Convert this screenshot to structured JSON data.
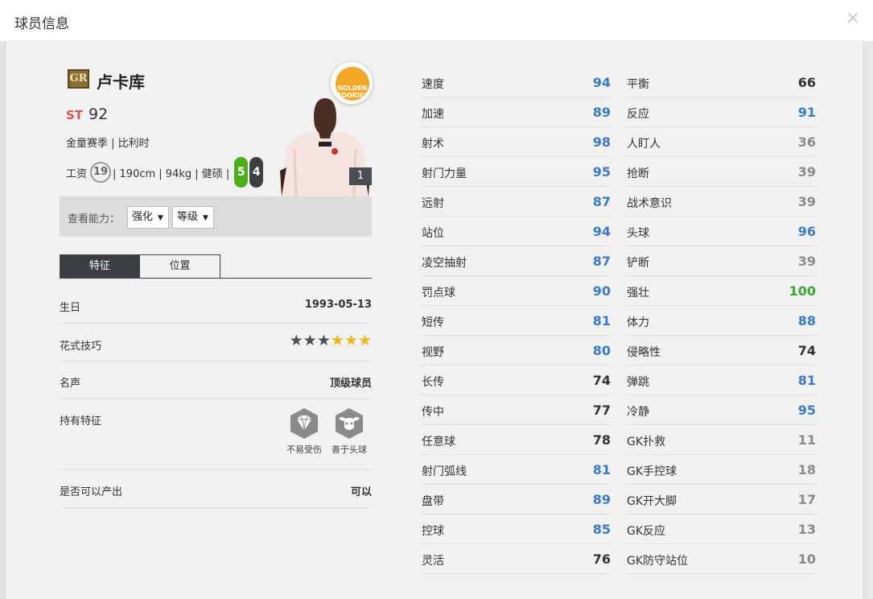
{
  "dialog": {
    "title": "球员信息",
    "close_label": "×"
  },
  "player": {
    "grade": "GR",
    "name": "卢卡库",
    "position": "ST",
    "overall": "92",
    "season_line": "金童赛季 | 比利时",
    "salary_prefix": "工资",
    "salary": "19",
    "body_line": "| 190cm | 94kg | 健硕 |",
    "left_foot": "5",
    "right_foot": "4",
    "card_badge_text": "GOLDEN ROOKIES",
    "card_level": "1"
  },
  "filter": {
    "label": "查看能力：",
    "enhance": "强化",
    "level": "等级"
  },
  "tabs": [
    {
      "label": "特征",
      "active": true
    },
    {
      "label": "位置",
      "active": false
    }
  ],
  "info": {
    "birthday_label": "生日",
    "birthday": "1993-05-13",
    "skill_label": "花式技巧",
    "skill_stars": 3,
    "skill_stars_max": 6,
    "fame_label": "名声",
    "fame": "顶级球员",
    "traits_label": "持有特征",
    "traits": [
      {
        "label": "不易受伤",
        "icon": "diamond-icon"
      },
      {
        "label": "善于头球",
        "icon": "bull-icon"
      }
    ],
    "produce_label": "是否可以产出",
    "produce": "可以"
  },
  "colors": {
    "blue": "#3a7bc4",
    "dark": "#333333",
    "gray": "#8a8a8a",
    "green": "#3aa832"
  },
  "stats_left": [
    {
      "name": "速度",
      "value": "94",
      "color": "blue"
    },
    {
      "name": "加速",
      "value": "89",
      "color": "blue"
    },
    {
      "name": "射术",
      "value": "98",
      "color": "blue"
    },
    {
      "name": "射门力量",
      "value": "95",
      "color": "blue"
    },
    {
      "name": "远射",
      "value": "87",
      "color": "blue"
    },
    {
      "name": "站位",
      "value": "94",
      "color": "blue"
    },
    {
      "name": "凌空抽射",
      "value": "87",
      "color": "blue"
    },
    {
      "name": "罚点球",
      "value": "90",
      "color": "blue"
    },
    {
      "name": "短传",
      "value": "81",
      "color": "blue"
    },
    {
      "name": "视野",
      "value": "80",
      "color": "blue"
    },
    {
      "name": "长传",
      "value": "74",
      "color": "dark"
    },
    {
      "name": "传中",
      "value": "77",
      "color": "dark"
    },
    {
      "name": "任意球",
      "value": "78",
      "color": "dark"
    },
    {
      "name": "射门弧线",
      "value": "81",
      "color": "blue"
    },
    {
      "name": "盘带",
      "value": "89",
      "color": "blue"
    },
    {
      "name": "控球",
      "value": "85",
      "color": "blue"
    },
    {
      "name": "灵活",
      "value": "76",
      "color": "dark"
    }
  ],
  "stats_right": [
    {
      "name": "平衡",
      "value": "66",
      "color": "dark"
    },
    {
      "name": "反应",
      "value": "91",
      "color": "blue"
    },
    {
      "name": "人盯人",
      "value": "36",
      "color": "gray"
    },
    {
      "name": "抢断",
      "value": "39",
      "color": "gray"
    },
    {
      "name": "战术意识",
      "value": "39",
      "color": "gray"
    },
    {
      "name": "头球",
      "value": "96",
      "color": "blue"
    },
    {
      "name": "铲断",
      "value": "39",
      "color": "gray"
    },
    {
      "name": "强壮",
      "value": "100",
      "color": "green"
    },
    {
      "name": "体力",
      "value": "88",
      "color": "blue"
    },
    {
      "name": "侵略性",
      "value": "74",
      "color": "dark"
    },
    {
      "name": "弹跳",
      "value": "81",
      "color": "blue"
    },
    {
      "name": "冷静",
      "value": "95",
      "color": "blue"
    },
    {
      "name": "GK扑救",
      "value": "11",
      "color": "gray"
    },
    {
      "name": "GK手控球",
      "value": "18",
      "color": "gray"
    },
    {
      "name": "GK开大脚",
      "value": "17",
      "color": "gray"
    },
    {
      "name": "GK反应",
      "value": "13",
      "color": "gray"
    },
    {
      "name": "GK防守站位",
      "value": "10",
      "color": "gray"
    }
  ]
}
